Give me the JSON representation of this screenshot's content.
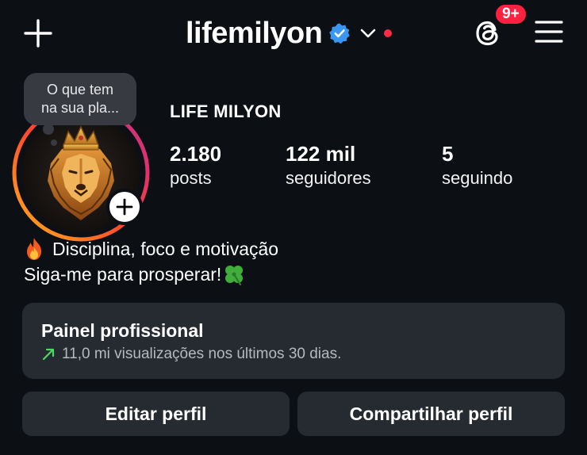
{
  "header": {
    "username": "lifemilyon",
    "verified_icon": "verified-badge-icon",
    "threads_badge": "9+",
    "colors": {
      "verified": "#3897f0",
      "notification": "#ff2140"
    }
  },
  "profile": {
    "note": [
      "O que tem",
      "na sua pla..."
    ],
    "display_name": "LIFE MILYON",
    "stats": [
      {
        "value": "2.180",
        "label": "posts"
      },
      {
        "value": "122 mil",
        "label": "seguidores"
      },
      {
        "value": "5",
        "label": "seguindo"
      }
    ],
    "bio": [
      {
        "icon": "fire-emoji",
        "text": "Disciplina, foco e motivação"
      },
      {
        "icon": "four-leaf-clover-emoji",
        "text": "Siga-me para prosperar!"
      }
    ]
  },
  "dashboard": {
    "title": "Painel profissional",
    "subtitle": "11,0 mi visualizações nos últimos 30 dias.",
    "trend_color": "#4cd964"
  },
  "actions": {
    "edit": "Editar perfil",
    "share": "Compartilhar perfil"
  }
}
